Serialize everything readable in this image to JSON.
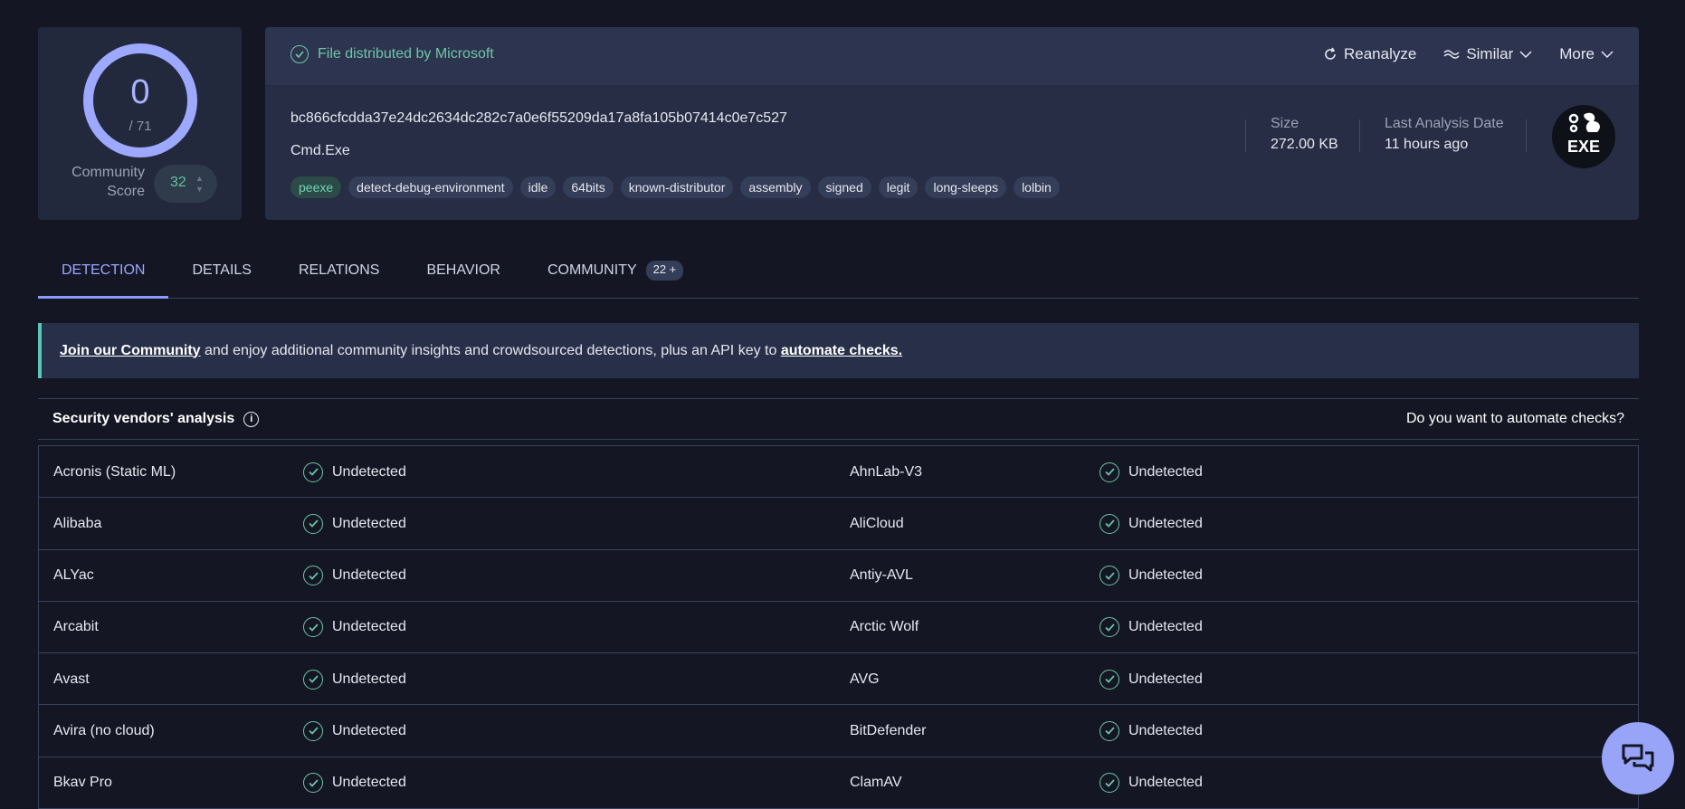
{
  "score": {
    "detections": "0",
    "total": "/ 71",
    "community_label": "Community Score",
    "community_value": "32"
  },
  "file": {
    "distribution_note": "File distributed by Microsoft",
    "hash": "bc866cfcdda37e24dc2634dc282c7a0e6f55209da17a8fa105b07414c0e7c527",
    "name": "Cmd.Exe",
    "tags": [
      "peexe",
      "detect-debug-environment",
      "idle",
      "64bits",
      "known-distributor",
      "assembly",
      "signed",
      "legit",
      "long-sleeps",
      "lolbin"
    ],
    "size_label": "Size",
    "size_value": "272.00 KB",
    "date_label": "Last Analysis Date",
    "date_value": "11 hours ago",
    "type_icon_text": "EXE"
  },
  "actions": {
    "reanalyze": "Reanalyze",
    "similar": "Similar",
    "more": "More"
  },
  "tabs": [
    {
      "label": "DETECTION",
      "active": true
    },
    {
      "label": "DETAILS"
    },
    {
      "label": "RELATIONS"
    },
    {
      "label": "BEHAVIOR"
    },
    {
      "label": "COMMUNITY",
      "badge": "22 +"
    }
  ],
  "banner": {
    "link1": "Join our Community",
    "middle": " and enjoy additional community insights and crowdsourced detections, plus an API key to ",
    "link2": "automate checks."
  },
  "vendors": {
    "title": "Security vendors' analysis",
    "automate_prompt": "Do you want to automate checks?",
    "rows": [
      [
        {
          "name": "Acronis (Static ML)",
          "result": "Undetected"
        },
        {
          "name": "AhnLab-V3",
          "result": "Undetected"
        }
      ],
      [
        {
          "name": "Alibaba",
          "result": "Undetected"
        },
        {
          "name": "AliCloud",
          "result": "Undetected"
        }
      ],
      [
        {
          "name": "ALYac",
          "result": "Undetected"
        },
        {
          "name": "Antiy-AVL",
          "result": "Undetected"
        }
      ],
      [
        {
          "name": "Arcabit",
          "result": "Undetected"
        },
        {
          "name": "Arctic Wolf",
          "result": "Undetected"
        }
      ],
      [
        {
          "name": "Avast",
          "result": "Undetected"
        },
        {
          "name": "AVG",
          "result": "Undetected"
        }
      ],
      [
        {
          "name": "Avira (no cloud)",
          "result": "Undetected"
        },
        {
          "name": "BitDefender",
          "result": "Undetected"
        }
      ],
      [
        {
          "name": "Bkav Pro",
          "result": "Undetected"
        },
        {
          "name": "ClamAV",
          "result": "Undetected"
        }
      ]
    ]
  },
  "colors": {
    "background": "#141624",
    "accent": "#9ca9ff",
    "success": "#6fc6a6"
  }
}
